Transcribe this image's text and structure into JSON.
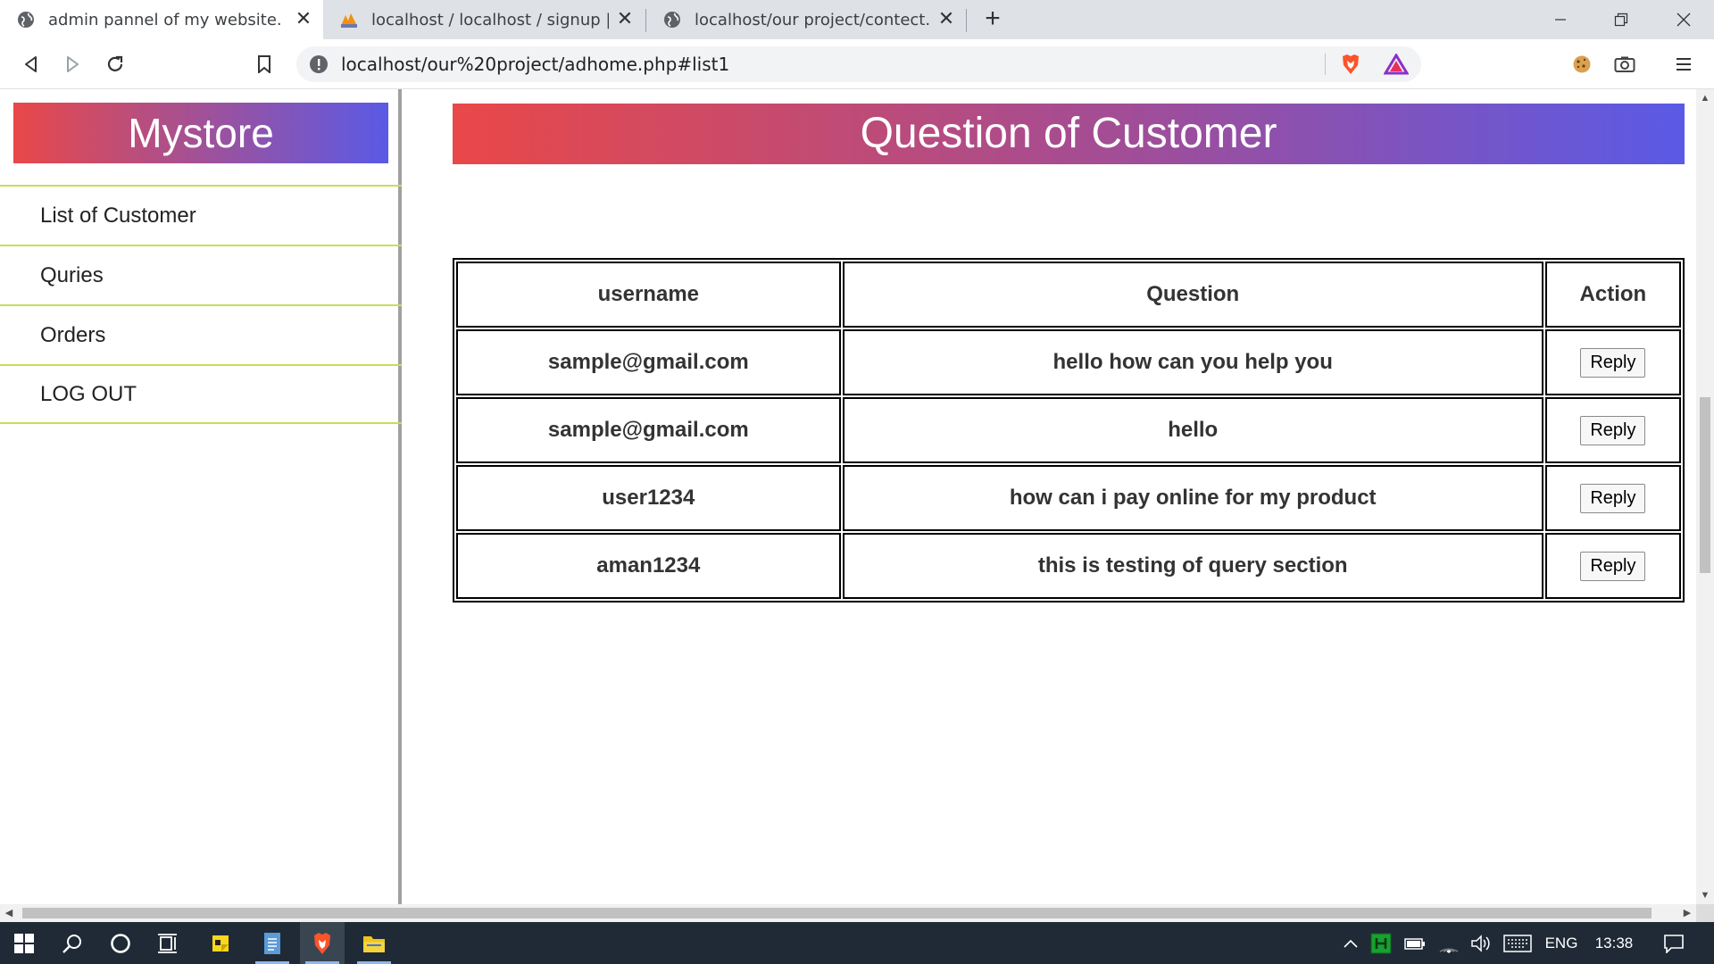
{
  "browser": {
    "tabs": [
      {
        "title": "admin pannel of my website.",
        "active": true,
        "icon": "globe-icon"
      },
      {
        "title": "localhost / localhost / signup | php",
        "active": false,
        "icon": "phpmyadmin-icon"
      },
      {
        "title": "localhost/our project/contect.php",
        "active": false,
        "icon": "globe-icon"
      }
    ],
    "url": "localhost/our%20project/adhome.php#list1"
  },
  "sidebar": {
    "brand": "Mystore",
    "items": [
      {
        "label": "List of Customer"
      },
      {
        "label": "Quries"
      },
      {
        "label": "Orders"
      },
      {
        "label": "LOG OUT"
      }
    ]
  },
  "main": {
    "title": "Question of Customer",
    "table": {
      "headers": [
        "username",
        "Question",
        "Action"
      ],
      "rows": [
        {
          "username": "sample@gmail.com",
          "question": "hello how can you help you",
          "action": "Reply"
        },
        {
          "username": "sample@gmail.com",
          "question": "hello",
          "action": "Reply"
        },
        {
          "username": "user1234",
          "question": "how can i pay online for my product",
          "action": "Reply"
        },
        {
          "username": "aman1234",
          "question": "this is testing of query section",
          "action": "Reply"
        }
      ]
    }
  },
  "taskbar": {
    "language": "ENG",
    "time": "13:38"
  },
  "colors": {
    "gradient_start": "#e94848",
    "gradient_end": "#5a5ae6",
    "nav_divider": "#c3e05a",
    "taskbar": "#1f2a36"
  }
}
